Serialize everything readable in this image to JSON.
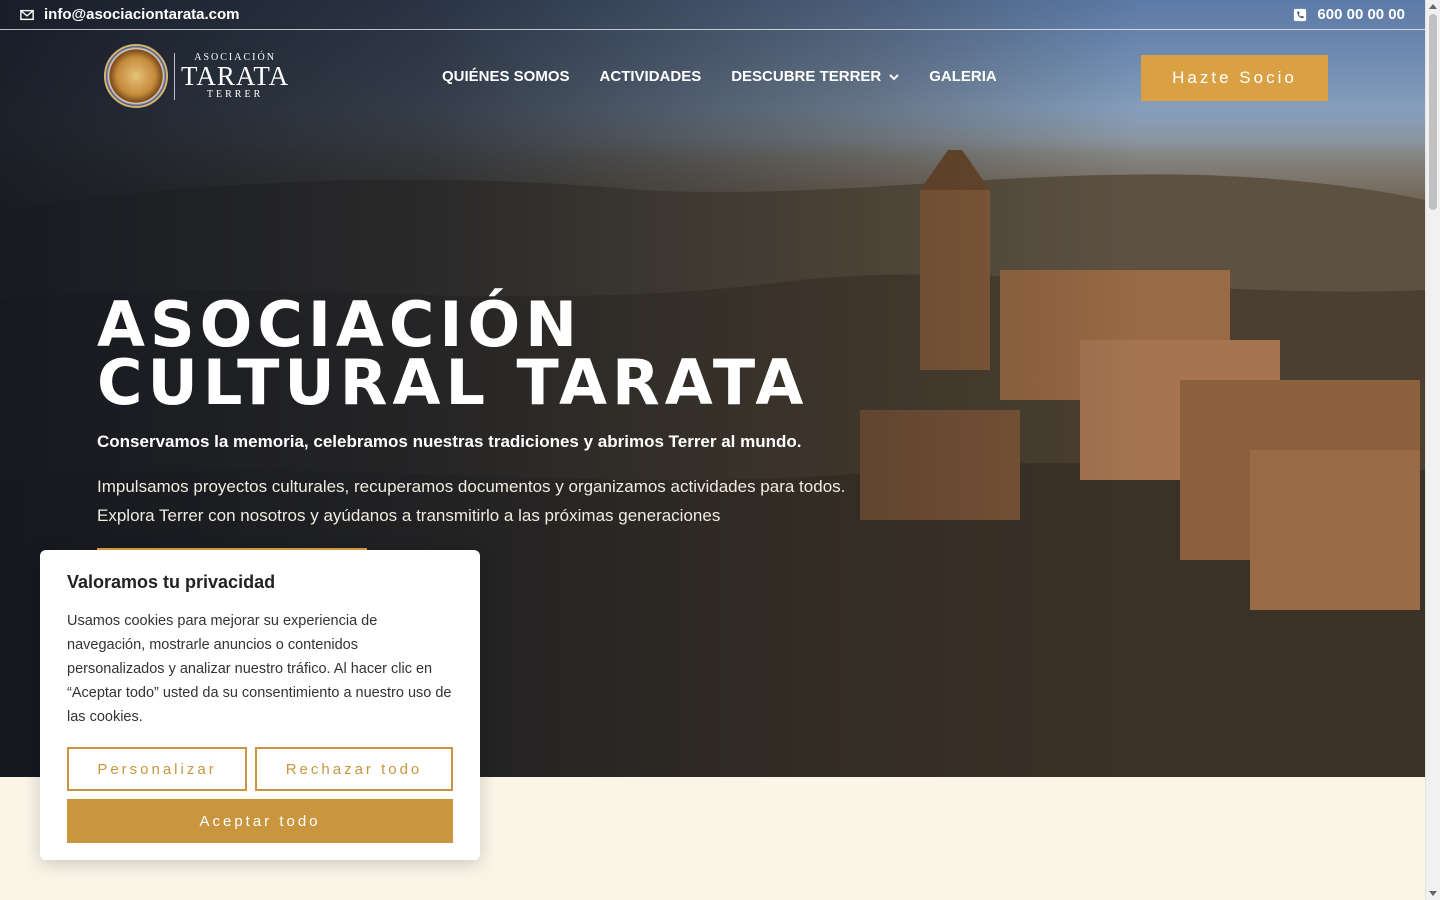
{
  "topbar": {
    "email": "info@asociaciontarata.com",
    "phone": "600 00 00 00"
  },
  "logo": {
    "line1": "ASOCIACIÓN",
    "line2": "TARATA",
    "line3": "TERRER"
  },
  "nav": {
    "items": [
      "QUIÉNES SOMOS",
      "ACTIVIDADES",
      "DESCUBRE TERRER",
      "GALERIA"
    ]
  },
  "cta": {
    "label": "Hazte Socio"
  },
  "hero": {
    "title_line1": "ASOCIACIÓN",
    "title_line2": "CULTURAL TARATA",
    "lead": "Conservamos la memoria, celebramos nuestras tradiciones y abrimos Terrer al mundo.",
    "description": "Impulsamos proyectos culturales, recuperamos documentos y organizamos actividades para todos. Explora Terrer con nosotros y ayúdanos a transmitirlo a las próximas generaciones"
  },
  "cookie": {
    "title": "Valoramos tu privacidad",
    "body": "Usamos cookies para mejorar su experiencia de navegación, mostrarle anuncios o contenidos personalizados y analizar nuestro tráfico. Al hacer clic en “Aceptar todo” usted da su consentimiento a nuestro uso de las cookies.",
    "customize": "Personalizar",
    "reject": "Rechazar todo",
    "accept": "Aceptar todo"
  },
  "colors": {
    "accent": "#d9a144",
    "cookie_accent": "#c9963f",
    "section_bg": "#fbf5e8"
  }
}
